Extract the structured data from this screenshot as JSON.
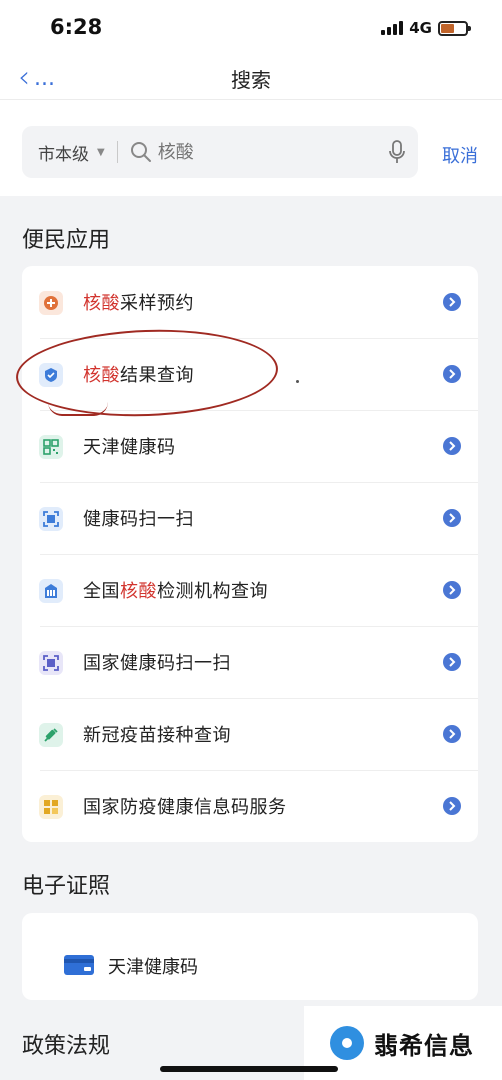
{
  "status_bar": {
    "time": "6:28",
    "network": "4G"
  },
  "nav": {
    "back_label": "...",
    "title": "搜索"
  },
  "search": {
    "city": "市本级",
    "placeholder": "核酸",
    "cancel_label": "取消"
  },
  "sections": {
    "convenience": "便民应用",
    "e_certificates": "电子证照",
    "policy": "政策法规"
  },
  "apps": [
    {
      "pre": "",
      "hl": "核酸",
      "post": "采样预约",
      "icon": "plus-circle-icon",
      "icon_bg": "#fbe7dc",
      "icon_color": "#e0713a"
    },
    {
      "pre": "",
      "hl": "核酸",
      "post": "结果查询",
      "icon": "shield-check-icon",
      "icon_bg": "#e1ecfb",
      "icon_color": "#3d7cd9"
    },
    {
      "pre": "天津健康码",
      "hl": "",
      "post": "",
      "icon": "qr-code-icon",
      "icon_bg": "#dff3ea",
      "icon_color": "#2da26b"
    },
    {
      "pre": "健康码扫一扫",
      "hl": "",
      "post": "",
      "icon": "scan-icon",
      "icon_bg": "#e1ecfb",
      "icon_color": "#3d7cd9"
    },
    {
      "pre": "全国",
      "hl": "核酸",
      "post": "检测机构查询",
      "icon": "building-icon",
      "icon_bg": "#e1ecfb",
      "icon_color": "#3d7cd9"
    },
    {
      "pre": "国家健康码扫一扫",
      "hl": "",
      "post": "",
      "icon": "scan-icon",
      "icon_bg": "#e8e6f8",
      "icon_color": "#5b5fc7"
    },
    {
      "pre": "新冠疫苗接种查询",
      "hl": "",
      "post": "",
      "icon": "syringe-icon",
      "icon_bg": "#dff3ea",
      "icon_color": "#2da26b"
    },
    {
      "pre": "国家防疫健康信息码服务",
      "hl": "",
      "post": "",
      "icon": "grid-icon",
      "icon_bg": "#fbf0d6",
      "icon_color": "#e2a823"
    }
  ],
  "certificate": {
    "label": "天津健康码",
    "icon": "card-icon",
    "icon_color": "#2f6fd6"
  },
  "watermark": {
    "text": "翡希信息"
  },
  "colors": {
    "accent": "#3a6fd8",
    "highlight": "#d2352f",
    "annotation": "#a02a22"
  }
}
